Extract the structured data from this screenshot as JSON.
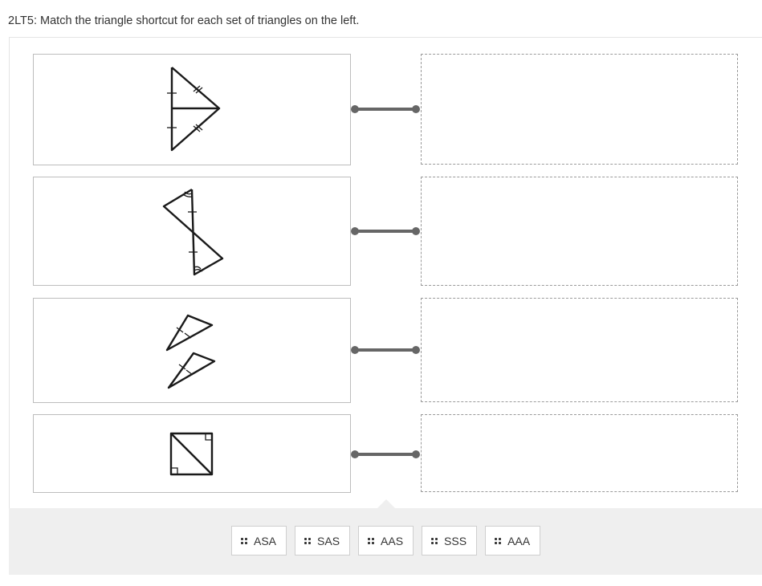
{
  "question": {
    "text": "2LT5: Match the triangle shortcut for each set of triangles on the left."
  },
  "items": [
    {
      "figure": "kite-shared-side-figure-icon"
    },
    {
      "figure": "bowtie-vertical-angle-figure-icon"
    },
    {
      "figure": "two-separate-triangles-figure-icon"
    },
    {
      "figure": "square-with-diagonal-figure-icon"
    }
  ],
  "targets": [
    {
      "value": ""
    },
    {
      "value": ""
    },
    {
      "value": ""
    },
    {
      "value": ""
    }
  ],
  "answer_bank": {
    "chips": [
      {
        "label": "ASA",
        "icon": "drag-handle-icon"
      },
      {
        "label": "SAS",
        "icon": "drag-handle-icon"
      },
      {
        "label": "AAS",
        "icon": "drag-handle-icon"
      },
      {
        "label": "SSS",
        "icon": "drag-handle-icon"
      },
      {
        "label": "AAA",
        "icon": "drag-handle-icon"
      }
    ]
  },
  "colors": {
    "connector": "#666666",
    "tray_background": "#efefef",
    "dashed_border": "#9a9a9a",
    "item_border": "#bdbdbd"
  }
}
